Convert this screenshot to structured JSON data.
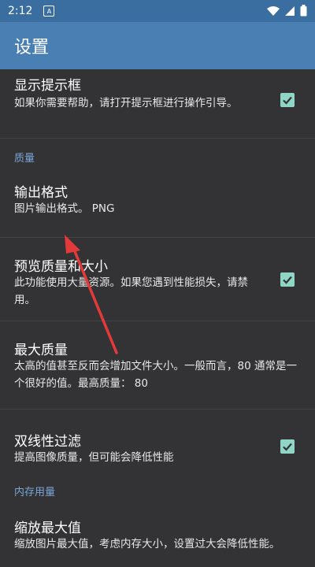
{
  "status_bar": {
    "time": "2:12"
  },
  "app_bar": {
    "title": "设置"
  },
  "prefs": {
    "show_hint": {
      "title": "显示提示框",
      "summary": "如果你需要帮助，请打开提示框进行操作引导。",
      "checked": true
    },
    "category_quality": "质量",
    "output_format": {
      "title": "输出格式",
      "summary": "图片输出格式。 PNG"
    },
    "preview_quality": {
      "title": "预览质量和大小",
      "summary": "此功能使用大量资源。如果您遇到性能损失，请禁用。",
      "checked": true
    },
    "max_quality": {
      "title": "最大质量",
      "summary": "太高的值甚至反而会增加文件大小。一般而言，80 通常是一个很好的值。最高质量： 80"
    },
    "bilinear_filter": {
      "title": "双线性过滤",
      "summary": "提高图像质量，但可能会降低性能",
      "checked": true
    },
    "category_memory": "内存用量",
    "zoom_max": {
      "title": "缩放最大值",
      "summary": "缩放图片最大值，考虑内存大小，设置过大会降低性能。"
    }
  },
  "colors": {
    "status_bar": "#3a6ea0",
    "app_bar": "#4a7fb3",
    "background": "#333335",
    "checkbox": "#8fd6c7",
    "category": "#7aa6d6",
    "arrow": "#e23a3a"
  }
}
